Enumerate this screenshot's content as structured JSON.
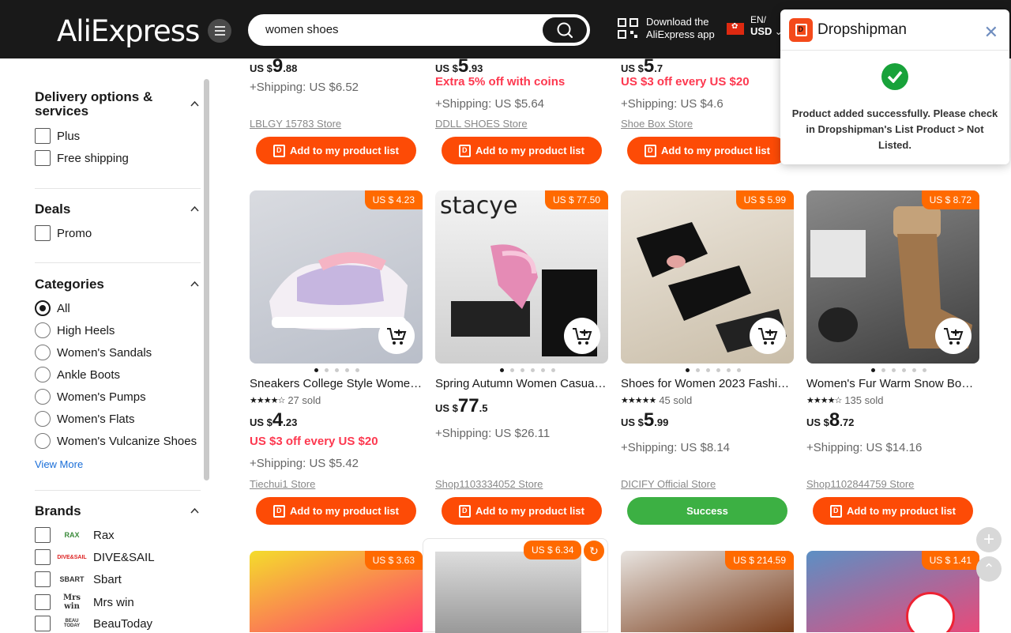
{
  "header": {
    "logo": "AliExpress",
    "search_value": "women shoes",
    "download_line1": "Download the",
    "download_line2": "AliExpress app",
    "lang": "EN/",
    "currency": "USD"
  },
  "sidebar": {
    "delivery_title_1": "Delivery options &",
    "delivery_title_2": "services",
    "delivery_options": [
      "Plus",
      "Free shipping"
    ],
    "deals_title": "Deals",
    "deals_options": [
      "Promo"
    ],
    "categories_title": "Categories",
    "categories": [
      "All",
      "High Heels",
      "Women's Sandals",
      "Ankle Boots",
      "Women's Pumps",
      "Women's Flats",
      "Women's Vulcanize Shoes"
    ],
    "view_more": "View More",
    "brands_title": "Brands",
    "brands": [
      {
        "name": "Rax",
        "logo": "RAX"
      },
      {
        "name": "DIVE&SAIL",
        "logo": "DIVE&SAIL"
      },
      {
        "name": "Sbart",
        "logo": "SBART"
      },
      {
        "name": "Mrs win",
        "logo": "Mrs win"
      },
      {
        "name": "BeauToday",
        "logo": "BEAU TODAY"
      }
    ]
  },
  "top_row": [
    {
      "currency": "US $",
      "int": "9",
      "dec": ".88",
      "promo": "",
      "shipping": "+Shipping: US $6.52",
      "store": "LBLGY 15783 Store",
      "button": "Add to my product list"
    },
    {
      "currency": "US $",
      "int": "5",
      "dec": ".93",
      "promo": "Extra 5% off with coins",
      "shipping": "+Shipping: US $5.64",
      "store": "DDLL SHOES Store",
      "button": "Add to my product list"
    },
    {
      "currency": "US $",
      "int": "5",
      "dec": ".7",
      "promo": "US $3 off every US $20",
      "shipping": "+Shipping: US $4.6",
      "store": "Shoe Box Store",
      "button": "Add to my product list"
    }
  ],
  "products": [
    {
      "badge": "US $ 4.23",
      "title": "Sneakers College Style Women ...",
      "rating": 3.5,
      "sold": "27 sold",
      "currency": "US $",
      "int": "4",
      "dec": ".23",
      "promo": "US $3 off every US $20",
      "shipping": "+Shipping: US $5.42",
      "store": "Tiechui1 Store",
      "button": "Add to my product list",
      "success": false
    },
    {
      "badge": "US $ 77.50",
      "title": "Spring Autumn Women Casual ...",
      "rating": 0,
      "sold": "",
      "currency": "US $",
      "int": "77",
      "dec": ".5",
      "promo": "",
      "shipping": "+Shipping: US $26.11",
      "store": "Shop1103334052 Store",
      "button": "Add to my product list",
      "success": false,
      "img_text": "stacye"
    },
    {
      "badge": "US $ 5.99",
      "title": "Shoes for Women 2023 Fashion...",
      "rating": 5,
      "sold": "45 sold",
      "currency": "US $",
      "int": "5",
      "dec": ".99",
      "promo": "",
      "shipping": "+Shipping: US $8.14",
      "store": "DICIFY Official Store",
      "button": "Success",
      "success": true
    },
    {
      "badge": "US $ 8.72",
      "title": "Women's Fur Warm Snow Boots...",
      "rating": 4.5,
      "sold": "135 sold",
      "currency": "US $",
      "int": "8",
      "dec": ".72",
      "promo": "",
      "shipping": "+Shipping: US $14.16",
      "store": "Shop1102844759 Store",
      "button": "Add to my product list",
      "success": false
    }
  ],
  "bottom_badges": [
    "US $ 3.63",
    "US $ 6.34",
    "US $ 214.59",
    "US $ 1.41"
  ],
  "popup": {
    "title": "Dropshipman",
    "message": "Product added successfully. Please check in Dropshipman's List Product > Not Listed."
  },
  "colors": {
    "accent": "#fd4b06",
    "success": "#3cb043",
    "promo": "#fd384f",
    "badge": "#ff6a00"
  }
}
